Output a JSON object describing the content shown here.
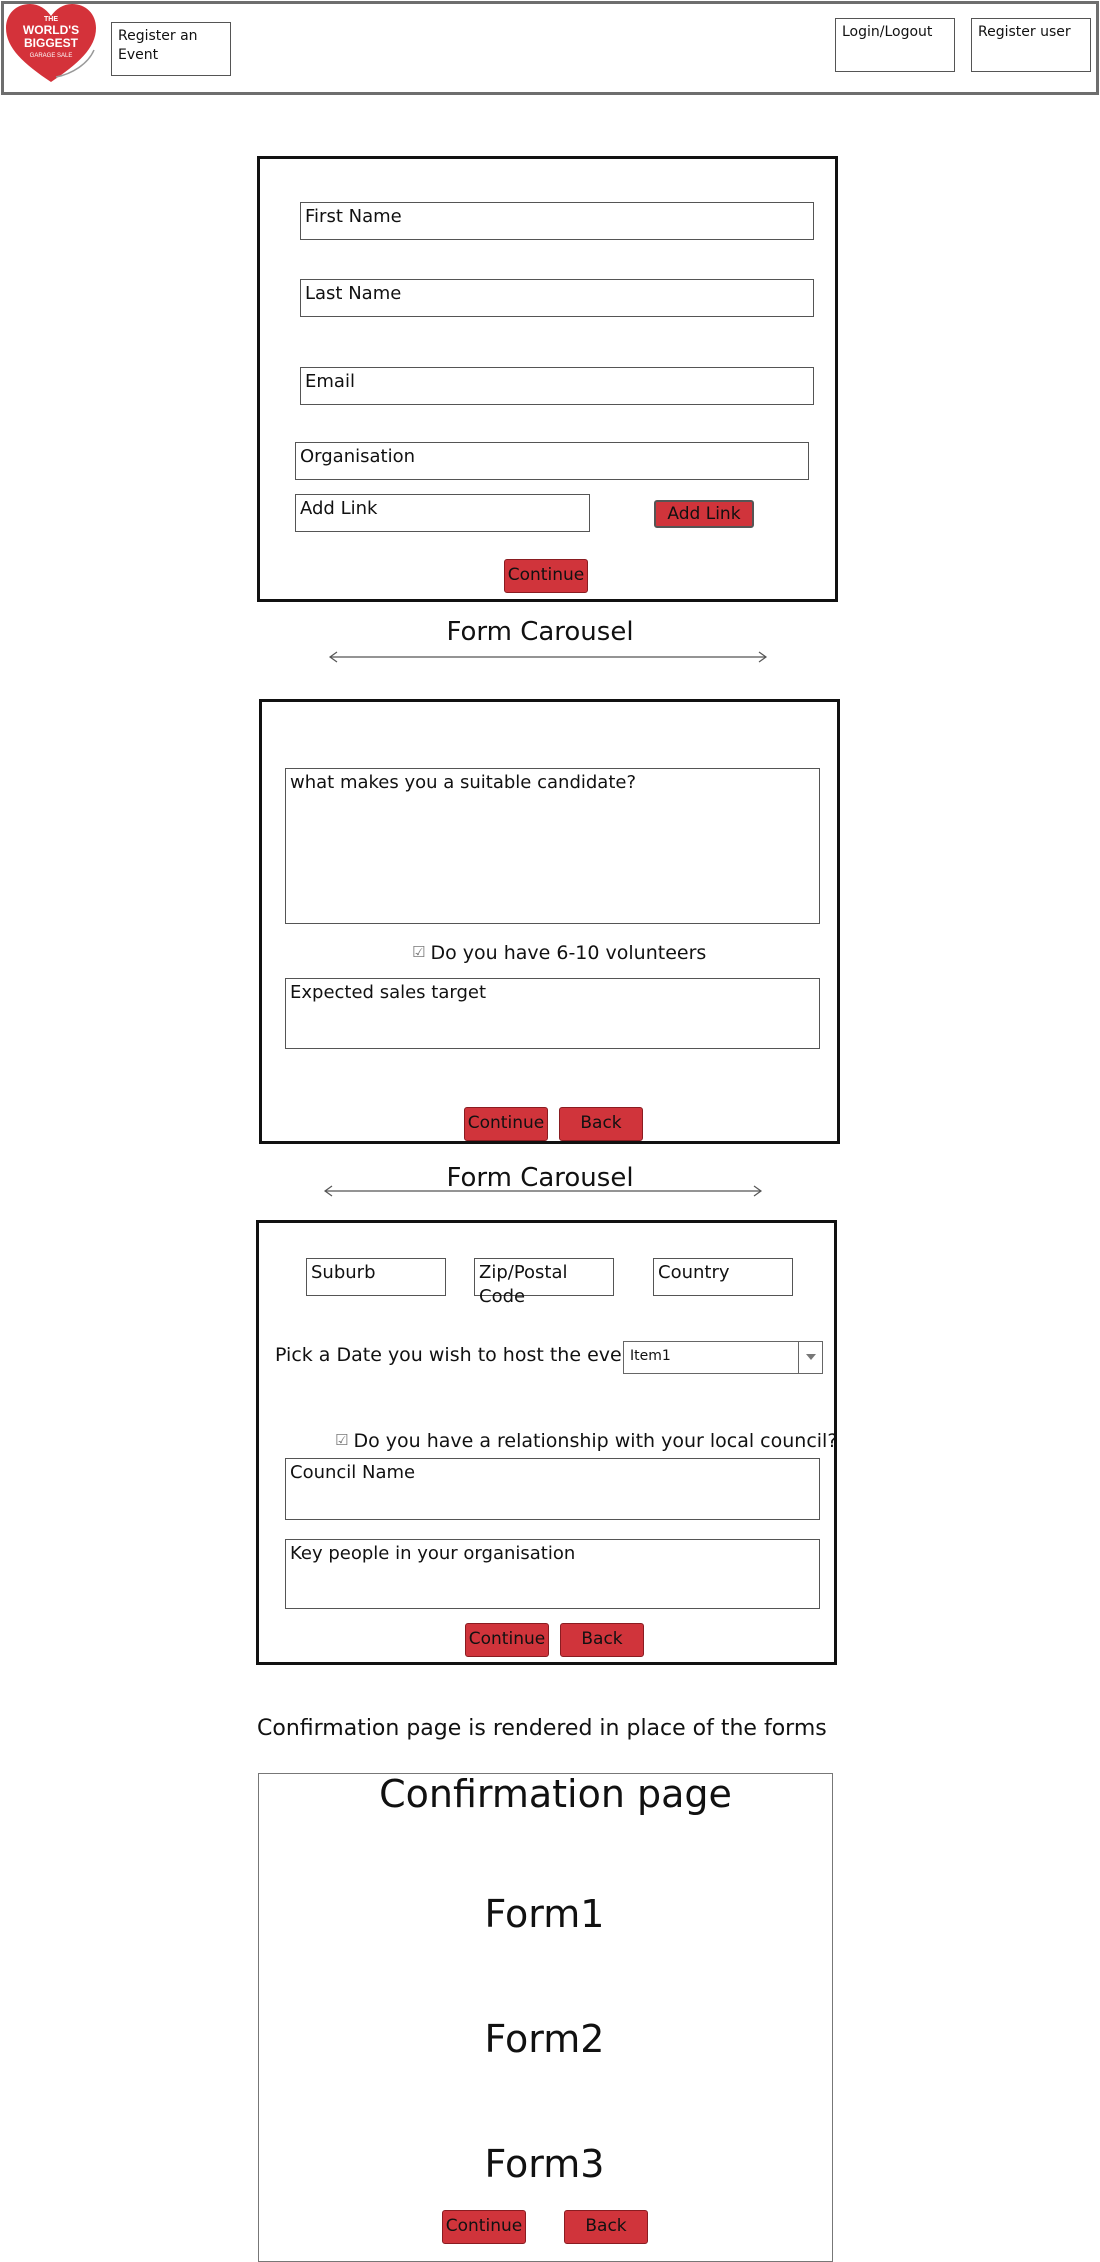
{
  "header": {
    "logo": {
      "top": "THE",
      "line1": "WORLD'S",
      "line2": "BIGGEST",
      "line3": "GARAGE SALE"
    },
    "register_event": "Register an Event",
    "login_logout": "Login/Logout",
    "register_user": "Register user"
  },
  "form1": {
    "first_name": "First Name",
    "last_name": "Last Name",
    "email": "Email",
    "organisation": "Organisation",
    "add_link_placeholder": "Add Link",
    "add_link_button": "Add Link",
    "continue": "Continue"
  },
  "carousel1": {
    "title": "Form Carousel"
  },
  "form2": {
    "candidate_question": "what makes you a suitable candidate?",
    "volunteers_check": "Do you have 6-10 volunteers",
    "sales_target": "Expected sales target",
    "continue": "Continue",
    "back": "Back"
  },
  "carousel2": {
    "title": "Form Carousel"
  },
  "form3": {
    "suburb": "Suburb",
    "zip": "Zip/Postal Code",
    "country": "Country",
    "date_label": "Pick a Date you wish to host the event",
    "date_selected": "Item1",
    "council_check": "Do you have a relationship with your local council?",
    "council_name": "Council Name",
    "key_people": "Key people in your organisation",
    "continue": "Continue",
    "back": "Back"
  },
  "confirmation": {
    "note": "Confirmation page is rendered in place of the forms",
    "title": "Confirmation page",
    "form1": "Form1",
    "form2": "Form2",
    "form3": "Form3",
    "continue": "Continue",
    "back": "Back"
  },
  "colors": {
    "accent": "#d0343b",
    "logo_red": "#d4323a",
    "border": "#111111"
  }
}
